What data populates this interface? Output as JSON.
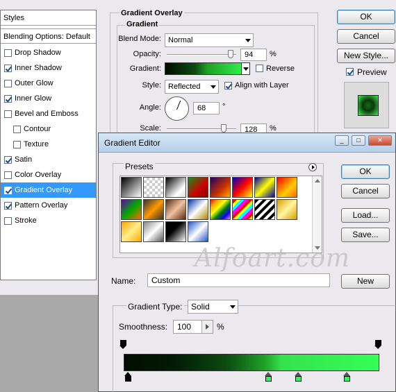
{
  "layer_style": {
    "styles_header": "Styles",
    "blending_options": "Blending Options: Default",
    "items": [
      {
        "label": "Drop Shadow",
        "checked": false
      },
      {
        "label": "Inner Shadow",
        "checked": true
      },
      {
        "label": "Outer Glow",
        "checked": false
      },
      {
        "label": "Inner Glow",
        "checked": true
      },
      {
        "label": "Bevel and Emboss",
        "checked": false
      },
      {
        "label": "Contour",
        "checked": false
      },
      {
        "label": "Texture",
        "checked": false
      },
      {
        "label": "Satin",
        "checked": true
      },
      {
        "label": "Color Overlay",
        "checked": false
      },
      {
        "label": "Gradient Overlay",
        "checked": true
      },
      {
        "label": "Pattern Overlay",
        "checked": true
      },
      {
        "label": "Stroke",
        "checked": false
      }
    ],
    "gradient_overlay": {
      "title": "Gradient Overlay",
      "subtitle": "Gradient",
      "blend_mode_label": "Blend Mode:",
      "blend_mode": "Normal",
      "opacity_label": "Opacity:",
      "opacity": "94",
      "opacity_unit": "%",
      "gradient_label": "Gradient:",
      "reverse_label": "Reverse",
      "style_label": "Style:",
      "style": "Reflected",
      "align_label": "Align with Layer",
      "angle_label": "Angle:",
      "angle": "68",
      "angle_unit": "°",
      "scale_label": "Scale:",
      "scale": "128",
      "scale_unit": "%"
    },
    "buttons": {
      "ok": "OK",
      "cancel": "Cancel",
      "new_style": "New Style...",
      "preview": "Preview"
    }
  },
  "gradient_editor": {
    "title": "Gradient Editor",
    "presets_label": "Presets",
    "buttons": {
      "ok": "OK",
      "cancel": "Cancel",
      "load": "Load...",
      "save": "Save...",
      "new": "New"
    },
    "name_label": "Name:",
    "name_value": "Custom",
    "gradient_type_label": "Gradient Type:",
    "gradient_type": "Solid",
    "smoothness_label": "Smoothness:",
    "smoothness": "100",
    "smoothness_unit": "%",
    "watermark": "Alfoart.com",
    "gradient_colors": [
      "#000d00",
      "#021c04",
      "#0c4a10",
      "#1fa026",
      "#35e24c",
      "#33ff55"
    ]
  }
}
